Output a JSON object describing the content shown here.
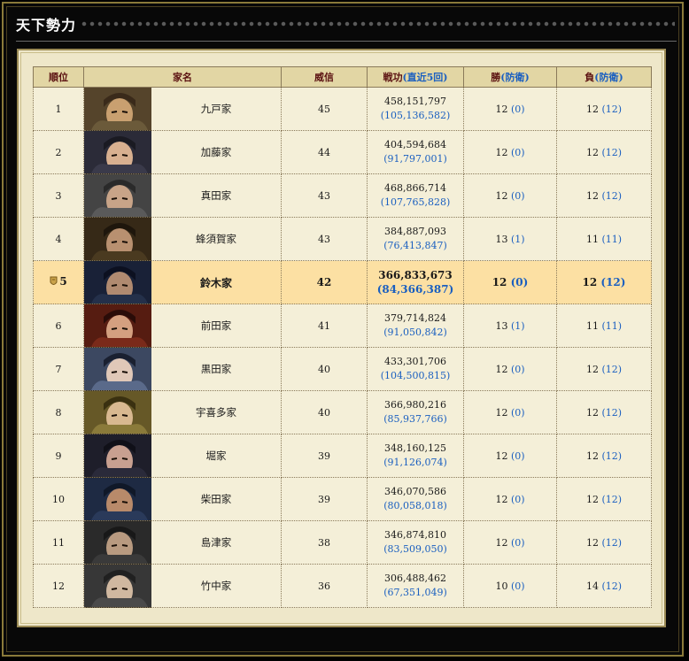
{
  "window": {
    "title": "天下勢力"
  },
  "table": {
    "headers": {
      "rank": "順位",
      "house": "家名",
      "prestige": "威信",
      "merit": "戦功",
      "merit_sub": "(直近5回)",
      "wins": "勝",
      "wins_sub": "(防衛)",
      "losses": "負",
      "losses_sub": "(防衛)"
    },
    "rows": [
      {
        "rank": "1",
        "house": "九戸家",
        "prestige": "45",
        "merit": "458,151,797",
        "merit_recent": "(105,136,582)",
        "wins": "12",
        "wins_def": "(0)",
        "losses": "12",
        "losses_def": "(12)",
        "portrait": "samurai-portrait-icon"
      },
      {
        "rank": "2",
        "house": "加藤家",
        "prestige": "44",
        "merit": "404,594,684",
        "merit_recent": "(91,797,001)",
        "wins": "12",
        "wins_def": "(0)",
        "losses": "12",
        "losses_def": "(12)",
        "portrait": "samurai-portrait-icon"
      },
      {
        "rank": "3",
        "house": "真田家",
        "prestige": "43",
        "merit": "468,866,714",
        "merit_recent": "(107,765,828)",
        "wins": "12",
        "wins_def": "(0)",
        "losses": "12",
        "losses_def": "(12)",
        "portrait": "samurai-portrait-icon"
      },
      {
        "rank": "4",
        "house": "蜂須賀家",
        "prestige": "43",
        "merit": "384,887,093",
        "merit_recent": "(76,413,847)",
        "wins": "13",
        "wins_def": "(1)",
        "losses": "11",
        "losses_def": "(11)",
        "portrait": "samurai-portrait-icon"
      },
      {
        "rank": "5",
        "house": "鈴木家",
        "prestige": "42",
        "merit": "366,833,673",
        "merit_recent": "(84,366,387)",
        "wins": "12",
        "wins_def": "(0)",
        "losses": "12",
        "losses_def": "(12)",
        "portrait": "samurai-portrait-icon",
        "highlight": true
      },
      {
        "rank": "6",
        "house": "前田家",
        "prestige": "41",
        "merit": "379,714,824",
        "merit_recent": "(91,050,842)",
        "wins": "13",
        "wins_def": "(1)",
        "losses": "11",
        "losses_def": "(11)",
        "portrait": "samurai-portrait-icon"
      },
      {
        "rank": "7",
        "house": "黒田家",
        "prestige": "40",
        "merit": "433,301,706",
        "merit_recent": "(104,500,815)",
        "wins": "12",
        "wins_def": "(0)",
        "losses": "12",
        "losses_def": "(12)",
        "portrait": "samurai-portrait-icon"
      },
      {
        "rank": "8",
        "house": "宇喜多家",
        "prestige": "40",
        "merit": "366,980,216",
        "merit_recent": "(85,937,766)",
        "wins": "12",
        "wins_def": "(0)",
        "losses": "12",
        "losses_def": "(12)",
        "portrait": "samurai-portrait-icon"
      },
      {
        "rank": "9",
        "house": "堀家",
        "prestige": "39",
        "merit": "348,160,125",
        "merit_recent": "(91,126,074)",
        "wins": "12",
        "wins_def": "(0)",
        "losses": "12",
        "losses_def": "(12)",
        "portrait": "samurai-portrait-icon"
      },
      {
        "rank": "10",
        "house": "柴田家",
        "prestige": "39",
        "merit": "346,070,586",
        "merit_recent": "(80,058,018)",
        "wins": "12",
        "wins_def": "(0)",
        "losses": "12",
        "losses_def": "(12)",
        "portrait": "samurai-portrait-icon"
      },
      {
        "rank": "11",
        "house": "島津家",
        "prestige": "38",
        "merit": "346,874,810",
        "merit_recent": "(83,509,050)",
        "wins": "12",
        "wins_def": "(0)",
        "losses": "12",
        "losses_def": "(12)",
        "portrait": "samurai-portrait-icon"
      },
      {
        "rank": "12",
        "house": "竹中家",
        "prestige": "36",
        "merit": "306,488,462",
        "merit_recent": "(67,351,049)",
        "wins": "10",
        "wins_def": "(0)",
        "losses": "14",
        "losses_def": "(12)",
        "portrait": "samurai-portrait-icon"
      }
    ]
  },
  "colors": {
    "header_bg": "#e2d6a4",
    "row_bg": "#f4efd8",
    "highlight_bg": "#fce0a3",
    "accent_blue": "#1a5fc0",
    "header_text": "#5a1010"
  },
  "portrait_palettes": [
    [
      "#6b5a3a",
      "#c9a070",
      "#3a2a1a"
    ],
    [
      "#3a3a4a",
      "#d8b090",
      "#1a1a22"
    ],
    [
      "#5a5a5a",
      "#c8a488",
      "#2a2a2a"
    ],
    [
      "#4a3a20",
      "#b89070",
      "#1e160c"
    ],
    [
      "#24304a",
      "#b08a70",
      "#0c1020"
    ],
    [
      "#7a2a1a",
      "#d4a080",
      "#2a0c08"
    ],
    [
      "#5a6a8a",
      "#e0c8b8",
      "#1a2030"
    ],
    [
      "#8a7a3a",
      "#d8b890",
      "#3a3010"
    ],
    [
      "#2a2a3a",
      "#c8a090",
      "#101018"
    ],
    [
      "#2a3a5a",
      "#b88a6a",
      "#101828"
    ],
    [
      "#3a3a3a",
      "#b89a80",
      "#181818"
    ],
    [
      "#4a4a4a",
      "#d0b8a0",
      "#202020"
    ]
  ]
}
